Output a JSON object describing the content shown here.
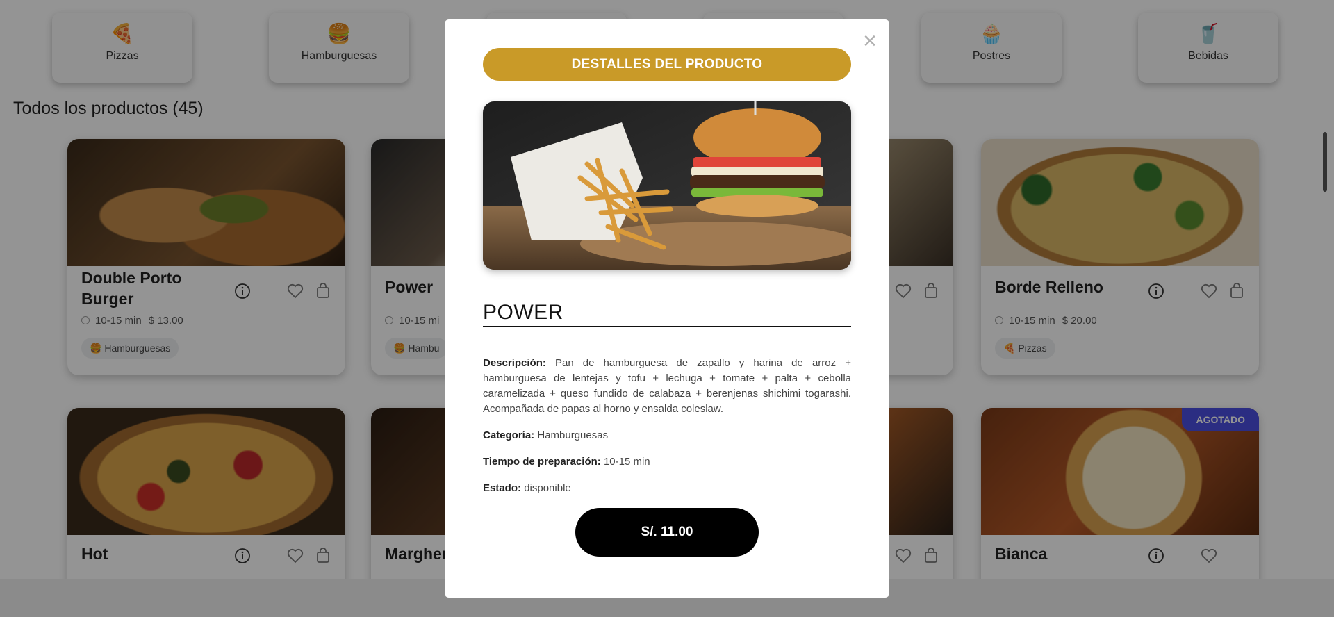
{
  "categories": [
    {
      "icon": "pizza-icon",
      "label": "Pizzas"
    },
    {
      "icon": "burger-icon",
      "label": "Hamburguesas"
    },
    {
      "icon": "cake-icon",
      "label": "Postres"
    },
    {
      "icon": "drink-icon",
      "label": "Bebidas"
    }
  ],
  "section": {
    "title": "Todos los productos (45)"
  },
  "products": [
    {
      "name": "Double Porto Burger",
      "time": "10-15 min",
      "price": "$ 13.00",
      "category": "Hamburguesas"
    },
    {
      "name": "Power",
      "time": "10-15 mi",
      "category": "Hambu"
    },
    {
      "name": "Borde Relleno",
      "time": "10-15 min",
      "price": "$ 20.00",
      "category": "Pizzas"
    },
    {
      "name": "Hot"
    },
    {
      "name": "Margher"
    },
    {
      "name": "Bianca",
      "badge": "AGOTADO"
    }
  ],
  "modal": {
    "header": "DESTALLES DEL PRODUCTO",
    "close_label": "×",
    "product_name": "POWER",
    "description_label": "Descripción:",
    "description": "Pan de hamburguesa de zapallo y harina de arroz + hamburguesa de lentejas y tofu + lechuga + tomate + palta + cebolla caramelizada + queso fundido de calabaza + berenjenas shichimi togarashi. Acompañada de papas al horno y ensalda coleslaw.",
    "category_label": "Categoría:",
    "category": "Hamburguesas",
    "prep_label": "Tiempo de preparación:",
    "prep": "10-15 min",
    "status_label": "Estado:",
    "status": "disponible",
    "price": "S/. 11.00"
  },
  "colors": {
    "accent": "#c99a28",
    "badge": "#4b4fe0",
    "overlay": "rgba(0,0,0,0.42)"
  }
}
